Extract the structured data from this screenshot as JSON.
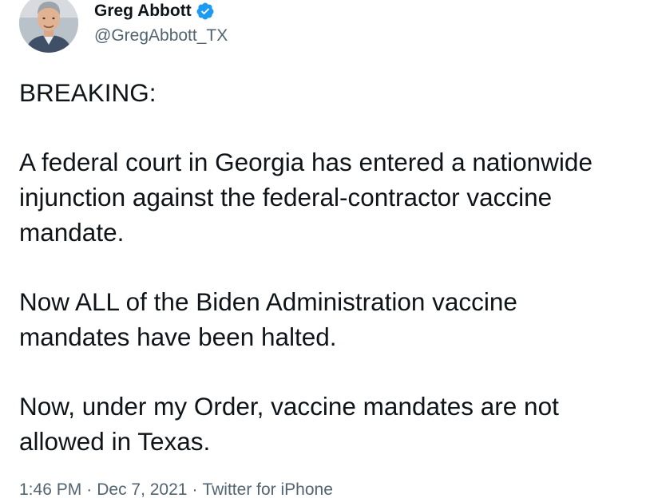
{
  "author": {
    "display_name": "Greg Abbott",
    "handle": "@GregAbbott_TX",
    "avatar_icon": "profile-photo",
    "verified_icon": "verified-badge-icon",
    "verified_color": "#1d9bf0"
  },
  "tweet": {
    "paragraphs": [
      [
        "BREAKING:"
      ],
      [
        "A federal court in Georgia has entered a nationwide",
        "injunction against the federal-contractor vaccine",
        "mandate."
      ],
      [
        "Now ALL of the Biden Administration vaccine",
        "mandates have been halted."
      ],
      [
        "Now, under my Order, vaccine mandates are not",
        "allowed in Texas."
      ]
    ]
  },
  "meta": {
    "time": "1:46 PM",
    "separator": "·",
    "date": "Dec 7, 2021",
    "source": "Twitter for iPhone"
  },
  "colors": {
    "text_primary": "#0f1419",
    "text_secondary": "#536471",
    "background": "#ffffff"
  }
}
